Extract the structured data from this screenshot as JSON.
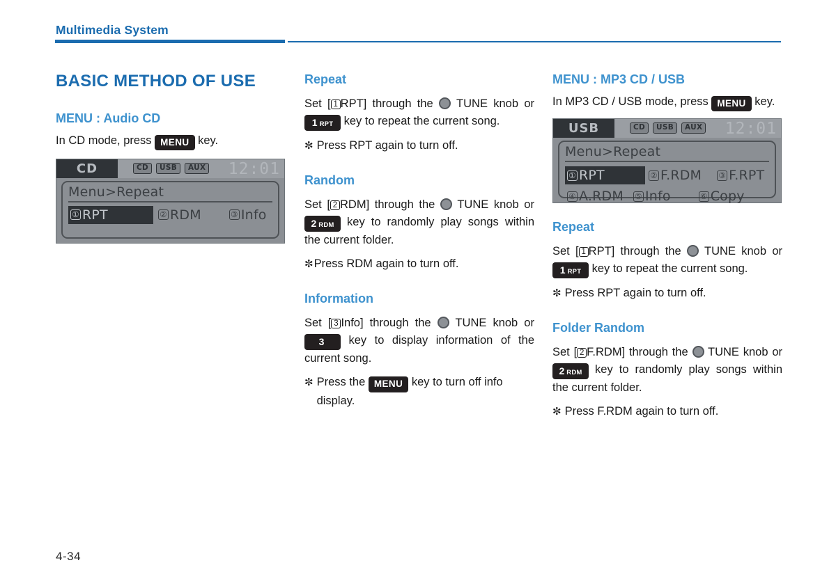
{
  "header": {
    "title": "Multimedia System"
  },
  "footer": {
    "page_number": "4-34"
  },
  "colors": {
    "brand_blue": "#1B6CAF",
    "subheading_blue": "#3E92CE",
    "lcd_background": "#8b8f94",
    "lcd_dark": "#2f3337",
    "keycap_dark": "#231f20"
  },
  "column1": {
    "main_heading": "BASIC METHOD OF USE",
    "section_heading": "MENU : Audio CD",
    "intro": {
      "before": "In CD mode, press",
      "key": "MENU",
      "after": "key."
    },
    "lcd": {
      "mode": "CD",
      "sources": [
        "CD",
        "USB",
        "AUX"
      ],
      "clock": "12:01",
      "breadcrumb": "Menu>Repeat",
      "items": [
        {
          "num": "①",
          "label": "RPT",
          "selected": true
        },
        {
          "num": "②",
          "label": "RDM",
          "selected": false
        },
        {
          "num": "③",
          "label": "Info",
          "selected": false
        }
      ]
    }
  },
  "column2": {
    "repeat": {
      "heading": "Repeat",
      "t1": "Set [",
      "num": "1",
      "t2": "RPT] through the",
      "t3": "TUNE knob or",
      "key_num": "1",
      "key_label": "RPT",
      "t4": "key to repeat the current song.",
      "note_symbol": "✼",
      "note": "Press RPT again to turn off."
    },
    "random": {
      "heading": "Random",
      "t1": "Set [",
      "num": "2",
      "t2": "RDM] through the",
      "t3": "TUNE knob or",
      "key_num": "2",
      "key_label": "RDM",
      "t4": "key to randomly play songs within the current folder.",
      "note_symbol": "✼",
      "note": "Press RDM again to turn off."
    },
    "information": {
      "heading": "Information",
      "t1": "Set [",
      "num": "3",
      "t2": "Info] through the",
      "t3": "TUNE knob or",
      "key_num": "3",
      "key_label": "",
      "t4": "key to display information of the current song.",
      "note_symbol": "✼",
      "note_before": "Press the",
      "note_key": "MENU",
      "note_after": "key to turn off info display."
    }
  },
  "column3": {
    "section_heading": "MENU : MP3 CD / USB",
    "intro": {
      "before": "In MP3 CD / USB mode, press",
      "key": "MENU",
      "after": "key."
    },
    "lcd": {
      "mode": "USB",
      "sources": [
        "CD",
        "USB",
        "AUX"
      ],
      "clock": "12:01",
      "breadcrumb": "Menu>Repeat",
      "items": [
        {
          "num": "①",
          "label": "RPT",
          "selected": true
        },
        {
          "num": "②",
          "label": "F.RDM",
          "selected": false
        },
        {
          "num": "③",
          "label": "F.RPT",
          "selected": false
        },
        {
          "num": "④",
          "label": "A.RDM",
          "selected": false
        },
        {
          "num": "⑤",
          "label": "Info",
          "selected": false
        },
        {
          "num": "⑥",
          "label": "Copy",
          "selected": false
        }
      ]
    },
    "repeat": {
      "heading": "Repeat",
      "t1": "Set [",
      "num": "1",
      "t2": "RPT] through the",
      "t3": "TUNE knob or",
      "key_num": "1",
      "key_label": "RPT",
      "t4": "key to repeat the current song.",
      "note_symbol": "✼",
      "note": "Press RPT again to turn off."
    },
    "folder_random": {
      "heading": "Folder Random",
      "t1": "Set [",
      "num": "2",
      "t2": "F.RDM] through the",
      "t3": "TUNE knob or",
      "key_num": "2",
      "key_label": "RDM",
      "t4": "key to randomly play songs within the current folder.",
      "note_symbol": "✼",
      "note": "Press F.RDM again to turn off."
    }
  }
}
